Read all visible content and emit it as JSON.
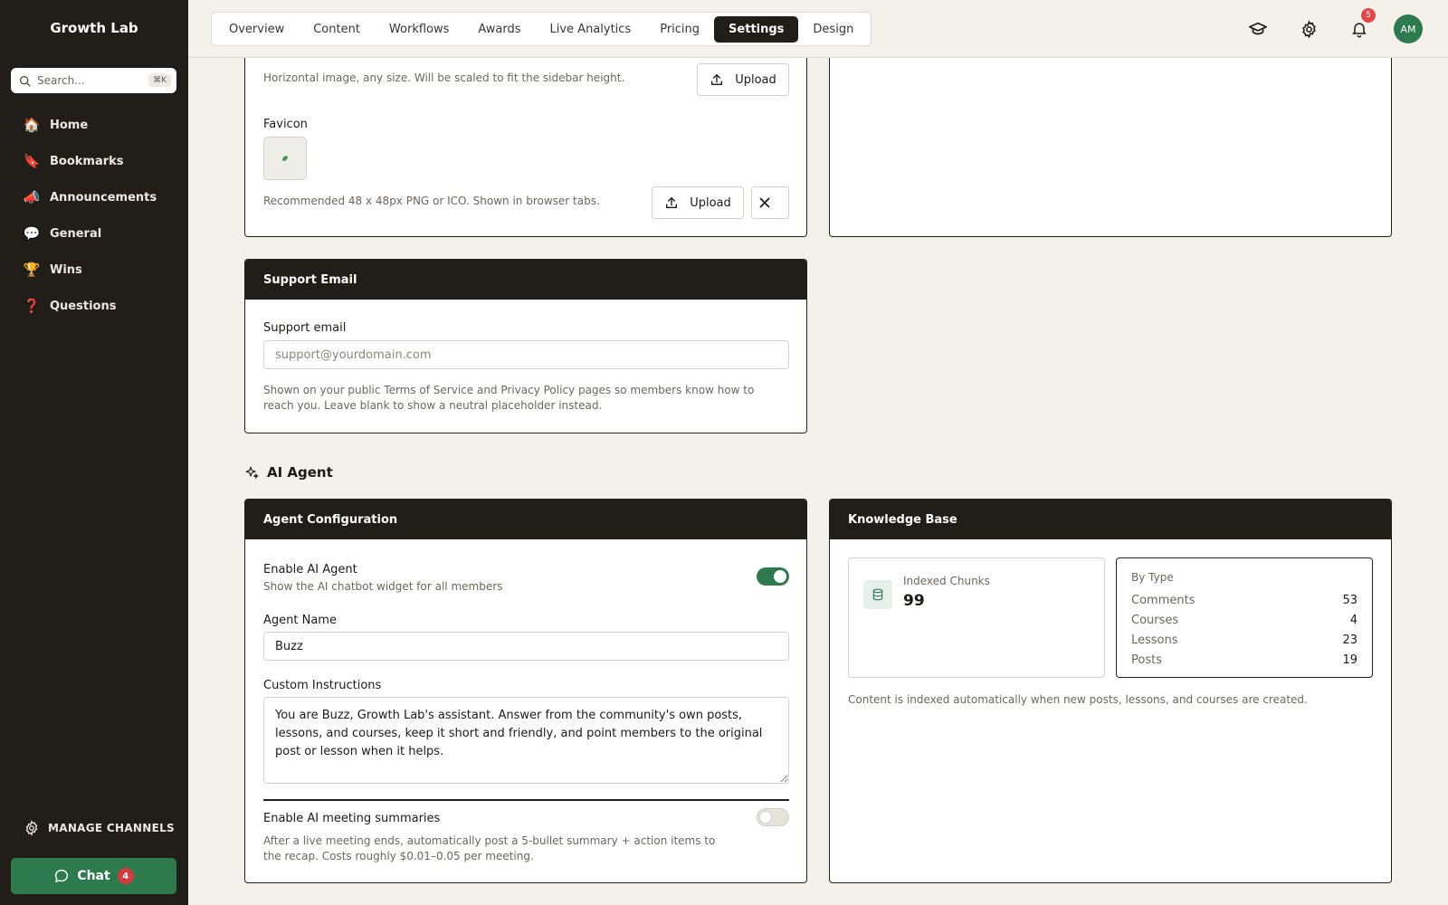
{
  "sidebar": {
    "brand": "Growth Lab",
    "search_placeholder": "Search...",
    "search_shortcut": "⌘K",
    "items": [
      {
        "emoji": "🏠",
        "label": "Home",
        "icon": "house-icon"
      },
      {
        "emoji": "🔖",
        "label": "Bookmarks",
        "icon": "bookmark-icon"
      },
      {
        "emoji": "📣",
        "label": "Announcements",
        "icon": "megaphone-icon"
      },
      {
        "emoji": "💬",
        "label": "General",
        "icon": "speech-bubble-icon"
      },
      {
        "emoji": "🏆",
        "label": "Wins",
        "icon": "trophy-icon"
      },
      {
        "emoji": "❓",
        "label": "Questions",
        "icon": "question-mark-icon"
      }
    ],
    "manage_label": "MANAGE CHANNELS",
    "chat_label": "Chat",
    "chat_count": "4"
  },
  "topbar": {
    "tabs": [
      "Overview",
      "Content",
      "Workflows",
      "Awards",
      "Live Analytics",
      "Pricing",
      "Settings",
      "Design"
    ],
    "active_tab": "Settings",
    "notification_count": "5",
    "avatar_initials": "AM"
  },
  "branding": {
    "logo_hint": "Horizontal image, any size. Will be scaled to fit the sidebar height.",
    "upload_label": "Upload",
    "favicon_label": "Favicon",
    "favicon_hint": "Recommended 48 x 48px PNG or ICO. Shown in browser tabs."
  },
  "support": {
    "title": "Support Email",
    "field_label": "Support email",
    "placeholder": "support@yourdomain.com",
    "value": "",
    "hint": "Shown on your public Terms of Service and Privacy Policy pages so members know how to reach you. Leave blank to show a neutral placeholder instead."
  },
  "ai_section_title": "AI Agent",
  "agent": {
    "title": "Agent Configuration",
    "enable_label": "Enable AI Agent",
    "enable_hint": "Show the AI chatbot widget for all members",
    "enabled": true,
    "name_label": "Agent Name",
    "name_value": "Buzz",
    "instructions_label": "Custom Instructions",
    "instructions_value": "You are Buzz, Growth Lab's assistant. Answer from the community's own posts, lessons, and courses, keep it short and friendly, and point members to the original post or lesson when it helps.",
    "summaries_label": "Enable AI meeting summaries",
    "summaries_hint": "After a live meeting ends, automatically post a 5-bullet summary + action items to the recap. Costs roughly $0.01–0.05 per meeting.",
    "summaries_enabled": false
  },
  "knowledge": {
    "title": "Knowledge Base",
    "chunks_label": "Indexed Chunks",
    "chunks_value": "99",
    "by_type_label": "By Type",
    "types": [
      {
        "name": "Comments",
        "count": "53"
      },
      {
        "name": "Courses",
        "count": "4"
      },
      {
        "name": "Lessons",
        "count": "23"
      },
      {
        "name": "Posts",
        "count": "19"
      }
    ],
    "note": "Content is indexed automatically when new posts, lessons, and courses are created."
  },
  "colors": {
    "sidebar_bg": "#211d19",
    "accent_green": "#2d7a4f",
    "page_bg": "#f3f1ea",
    "badge_red": "#d23b3b"
  }
}
